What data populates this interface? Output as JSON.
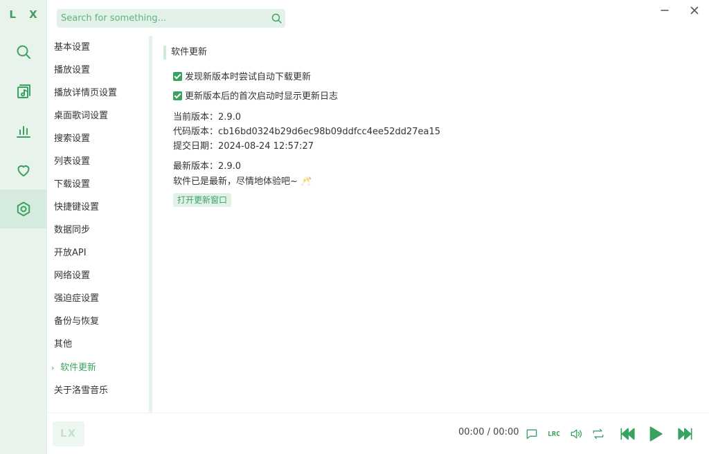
{
  "app": {
    "logo": "L X"
  },
  "search": {
    "placeholder": "Search for something..."
  },
  "rail": [
    {
      "name": "search-icon"
    },
    {
      "name": "music-library-icon"
    },
    {
      "name": "leaderboard-icon"
    },
    {
      "name": "heart-icon"
    },
    {
      "name": "settings-icon",
      "active": true
    }
  ],
  "settings_nav": [
    {
      "label": "基本设置"
    },
    {
      "label": "播放设置"
    },
    {
      "label": "播放详情页设置"
    },
    {
      "label": "桌面歌词设置"
    },
    {
      "label": "搜索设置"
    },
    {
      "label": "列表设置"
    },
    {
      "label": "下载设置"
    },
    {
      "label": "快捷键设置"
    },
    {
      "label": "数据同步"
    },
    {
      "label": "开放API"
    },
    {
      "label": "网络设置"
    },
    {
      "label": "强迫症设置"
    },
    {
      "label": "备份与恢复"
    },
    {
      "label": "其他"
    },
    {
      "label": "软件更新",
      "active": true
    },
    {
      "label": "关于洛雪音乐"
    }
  ],
  "update": {
    "title": "软件更新",
    "auto_download": "发现新版本时尝试自动下载更新",
    "show_changelog": "更新版本后的首次启动时显示更新日志",
    "current_version": "当前版本：2.9.0",
    "code_version": "代码版本：cb16bd0324b29d6ec98b09ddfcc4ee52dd27ea15",
    "commit_date": "提交日期：2024-08-24 12:57:27",
    "latest_version": "最新版本：2.9.0",
    "status": "软件已是最新，尽情地体验吧~ 🥂",
    "open_window_button": "打开更新窗口"
  },
  "player": {
    "logo": "LX",
    "time": "00:00 / 00:00",
    "lyric_toggle": "LRC"
  },
  "colors": {
    "accent": "#3aa261",
    "rail_bg": "#e8f3ec",
    "soft_bg": "#e3f2e8"
  }
}
